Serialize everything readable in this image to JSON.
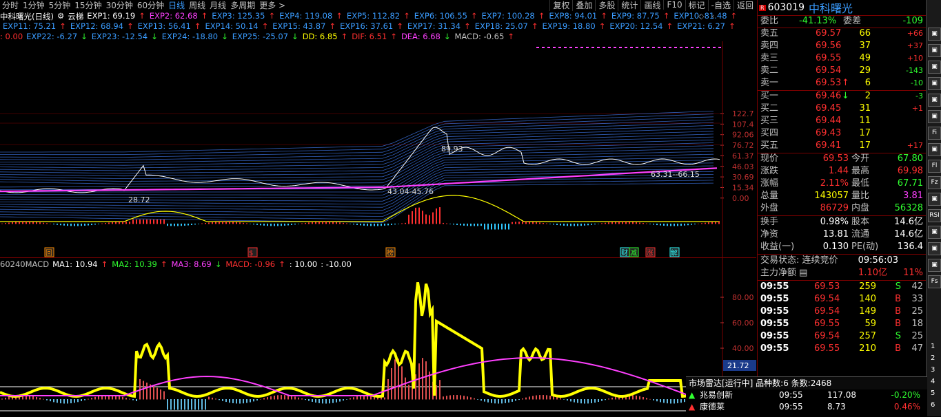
{
  "nav": {
    "periods": [
      "分时",
      "1分钟",
      "5分钟",
      "15分钟",
      "30分钟",
      "60分钟",
      "日线",
      "周线",
      "月线",
      "多周期",
      "更多 >"
    ],
    "active": "日线",
    "right_tabs": [
      "复权",
      "叠加",
      "多股",
      "统计",
      "画线",
      "F10",
      "标记",
      "-自选",
      "返回"
    ]
  },
  "legend1": {
    "title": "中科曙光(日线)",
    "indicator": "云梯",
    "items": [
      {
        "t": "EXP1: 69.19",
        "c": "#ffffff",
        "a": "↑",
        "ac": "#ff3030"
      },
      {
        "t": "EXP2: 62.68",
        "c": "#ff40ff",
        "a": "↑",
        "ac": "#ff3030"
      },
      {
        "t": "EXP3: 125.35",
        "c": "#3a9cff",
        "a": "↑",
        "ac": "#ff3030"
      },
      {
        "t": "EXP4: 119.08",
        "c": "#3a9cff",
        "a": "↑",
        "ac": "#ff3030"
      },
      {
        "t": "EXP5: 112.82",
        "c": "#3a9cff",
        "a": "↑",
        "ac": "#ff3030"
      },
      {
        "t": "EXP6: 106.55",
        "c": "#3a9cff",
        "a": "↑",
        "ac": "#ff3030"
      },
      {
        "t": "EXP7: 100.28",
        "c": "#3a9cff",
        "a": "↑",
        "ac": "#ff3030"
      },
      {
        "t": "EXP8: 94.01",
        "c": "#3a9cff",
        "a": "↑",
        "ac": "#ff3030"
      },
      {
        "t": "EXP9: 87.75",
        "c": "#3a9cff",
        "a": "↑",
        "ac": "#ff3030"
      },
      {
        "t": "EXP10: 81.48",
        "c": "#3a9cff",
        "a": "↑",
        "ac": "#ff3030"
      }
    ]
  },
  "legend2": {
    "items": [
      {
        "t": "EXP11: 75.21",
        "c": "#3a9cff",
        "a": "↑",
        "ac": "#ff3030"
      },
      {
        "t": "EXP12: 68.94",
        "c": "#3a9cff",
        "a": "↑",
        "ac": "#ff3030"
      },
      {
        "t": "EXP13: 56.41",
        "c": "#3a9cff",
        "a": "↑",
        "ac": "#ff3030"
      },
      {
        "t": "EXP14: 50.14",
        "c": "#3a9cff",
        "a": "↑",
        "ac": "#ff3030"
      },
      {
        "t": "EXP15: 43.87",
        "c": "#3a9cff",
        "a": "↑",
        "ac": "#ff3030"
      },
      {
        "t": "EXP16: 37.61",
        "c": "#3a9cff",
        "a": "↑",
        "ac": "#ff3030"
      },
      {
        "t": "EXP17: 31.34",
        "c": "#3a9cff",
        "a": "↑",
        "ac": "#ff3030"
      },
      {
        "t": "EXP18: 25.07",
        "c": "#3a9cff",
        "a": "↑",
        "ac": "#ff3030"
      },
      {
        "t": "EXP19: 18.80",
        "c": "#3a9cff",
        "a": "↑",
        "ac": "#ff3030"
      },
      {
        "t": "EXP20: 12.54",
        "c": "#3a9cff",
        "a": "↑",
        "ac": "#ff3030"
      },
      {
        "t": "EXP21: 6.27",
        "c": "#3a9cff",
        "a": "↑",
        "ac": "#ff3030"
      }
    ]
  },
  "legend3": {
    "items": [
      {
        "t": ": 0.00",
        "c": "#ff3030",
        "a": "",
        "ac": ""
      },
      {
        "t": "EXP22: -6.27",
        "c": "#3a9cff",
        "a": "↓",
        "ac": "#30ff30"
      },
      {
        "t": "EXP23: -12.54",
        "c": "#3a9cff",
        "a": "↓",
        "ac": "#30ff30"
      },
      {
        "t": "EXP24: -18.80",
        "c": "#3a9cff",
        "a": "↓",
        "ac": "#30ff30"
      },
      {
        "t": "EXP25: -25.07",
        "c": "#3a9cff",
        "a": "↓",
        "ac": "#30ff30"
      },
      {
        "t": "DD: 6.85",
        "c": "#ffff00",
        "a": "↑",
        "ac": "#ff3030"
      },
      {
        "t": "DIF: 6.51",
        "c": "#ff3030",
        "a": "↑",
        "ac": "#ff3030"
      },
      {
        "t": "DEA: 6.68",
        "c": "#ff40ff",
        "a": "↓",
        "ac": "#30ff30"
      },
      {
        "t": "MACD: -0.65",
        "c": "#c0c0c0",
        "a": "↑",
        "ac": "#ff3030"
      }
    ]
  },
  "legend_sub": {
    "items": [
      {
        "t": "60240MACD",
        "c": "#c0c0c0",
        "a": "",
        "ac": ""
      },
      {
        "t": "MA1: 10.94",
        "c": "#ffffff",
        "a": "↑",
        "ac": "#ff3030"
      },
      {
        "t": "MA2: 10.39",
        "c": "#30ff30",
        "a": "↑",
        "ac": "#ff3030"
      },
      {
        "t": "MA3: 8.69",
        "c": "#ff40ff",
        "a": "↓",
        "ac": "#30ff30"
      },
      {
        "t": "MACD: -0.96",
        "c": "#ff3030",
        "a": "↑",
        "ac": "#ff3030"
      },
      {
        "t": ": 10.00",
        "c": "#ffffff",
        "a": "",
        "ac": ""
      },
      {
        "t": ": -10.00",
        "c": "#ffffff",
        "a": "",
        "ac": ""
      }
    ]
  },
  "main_axis": [
    "122.7",
    "107.4",
    "92.06",
    "76.72",
    "61.37",
    "46.03",
    "30.69",
    "15.34",
    "0.00"
  ],
  "sub_axis": [
    "80.00",
    "60.00",
    "40.00"
  ],
  "sub_current": "21.72",
  "annotations": {
    "high": "89.93",
    "mid": "43.04-45.76",
    "low": "28.72",
    "range": "63.31--66.15"
  },
  "markers": [
    {
      "t": "回",
      "c": "#ff8c00"
    },
    {
      "t": "$",
      "c": "#ff3030"
    },
    {
      "t": "榜",
      "c": "#ff8c00"
    },
    {
      "t": "财",
      "c": "#30ffff"
    },
    {
      "t": "减",
      "c": "#30ff30"
    },
    {
      "t": "涨",
      "c": "#ff3030"
    },
    {
      "t": "解",
      "c": "#30ffff"
    }
  ],
  "quote": {
    "badge": "R",
    "code": "603019",
    "name": "中科曙光",
    "weibi_label": "委比",
    "weibi": "-41.13%",
    "weicha_label": "委差",
    "weicha": "-109",
    "asks": [
      {
        "l": "卖五",
        "p": "69.57",
        "v": "66",
        "d": "+66",
        "dc": "#ff3030"
      },
      {
        "l": "卖四",
        "p": "69.56",
        "v": "37",
        "d": "+37",
        "dc": "#ff3030"
      },
      {
        "l": "卖三",
        "p": "69.55",
        "v": "49",
        "d": "+10",
        "dc": "#ff3030"
      },
      {
        "l": "卖二",
        "p": "69.54",
        "v": "29",
        "d": "-143",
        "dc": "#30ff30"
      },
      {
        "l": "卖一",
        "p": "69.53",
        "v": "6",
        "d": "-10",
        "dc": "#30ff30",
        "arrow": "↑",
        "ac": "#ff3030"
      }
    ],
    "bids": [
      {
        "l": "买一",
        "p": "69.46",
        "v": "2",
        "d": "-3",
        "dc": "#30ff30",
        "arrow": "↓",
        "ac": "#30ff30"
      },
      {
        "l": "买二",
        "p": "69.45",
        "v": "31",
        "d": "+1",
        "dc": "#ff3030"
      },
      {
        "l": "买三",
        "p": "69.44",
        "v": "11",
        "d": "",
        "dc": "#ff3030"
      },
      {
        "l": "买四",
        "p": "69.43",
        "v": "17",
        "d": "",
        "dc": "#ff3030"
      },
      {
        "l": "买五",
        "p": "69.41",
        "v": "17",
        "d": "+17",
        "dc": "#ff3030"
      }
    ],
    "stats": [
      {
        "l1": "现价",
        "v1": "69.53",
        "c1": "#ff3030",
        "l2": "今开",
        "v2": "67.80",
        "c2": "#30ff30"
      },
      {
        "l1": "涨跌",
        "v1": "1.44",
        "c1": "#ff3030",
        "l2": "最高",
        "v2": "69.98",
        "c2": "#ff3030"
      },
      {
        "l1": "涨幅",
        "v1": "2.11%",
        "c1": "#ff3030",
        "l2": "最低",
        "v2": "67.71",
        "c2": "#30ff30"
      },
      {
        "l1": "总量",
        "v1": "143057",
        "c1": "#ffff00",
        "l2": "量比",
        "v2": "3.81",
        "c2": "#ff40ff"
      },
      {
        "l1": "外盘",
        "v1": "86729",
        "c1": "#ff3030",
        "l2": "内盘",
        "v2": "56328",
        "c2": "#30ff30"
      }
    ],
    "stats2": [
      {
        "l1": "换手",
        "v1": "0.98%",
        "c1": "#ffffff",
        "l2": "股本",
        "v2": "14.6亿",
        "c2": "#ffffff"
      },
      {
        "l1": "净资",
        "v1": "13.81",
        "c1": "#ffffff",
        "l2": "流通",
        "v2": "14.6亿",
        "c2": "#ffffff"
      },
      {
        "l1": "收益(一)",
        "v1": "0.130",
        "c1": "#ffffff",
        "l2": "PE(动)",
        "v2": "136.4",
        "c2": "#ffffff"
      }
    ],
    "trade_status_label": "交易状态: 连续竞价",
    "trade_status_time": "09:56:03",
    "flow_label": "主力净额",
    "flow_value": "1.10亿",
    "flow_pct": "11%",
    "ticks": [
      {
        "t": "09:55",
        "p": "69.53",
        "v": "259",
        "s": "S",
        "n": "42"
      },
      {
        "t": "09:55",
        "p": "69.54",
        "v": "140",
        "s": "B",
        "n": "33"
      },
      {
        "t": "09:55",
        "p": "69.54",
        "v": "149",
        "s": "B",
        "n": "25"
      },
      {
        "t": "09:55",
        "p": "69.55",
        "v": "59",
        "s": "B",
        "n": "18"
      },
      {
        "t": "09:55",
        "p": "69.54",
        "v": "257",
        "s": "S",
        "n": "25"
      },
      {
        "t": "09:55",
        "p": "69.55",
        "v": "210",
        "s": "B",
        "n": "47"
      }
    ]
  },
  "radar": {
    "title": "市场雷达[运行中] 品种数:6 条数:2468",
    "rows": [
      {
        "name": "兆易创新",
        "time": "09:55",
        "price": "117.08",
        "pct": "-0.20%",
        "pc": "#30ff30"
      },
      {
        "name": "康德莱",
        "time": "09:55",
        "price": "8.73",
        "pct": "0.46%",
        "pc": "#ff3030"
      }
    ]
  },
  "toolbar_icons": [
    "chart-icon",
    "grid-icon",
    "list-icon",
    "wave-icon",
    "candle-icon",
    "bar-icon",
    "fi-icon",
    "diagram-icon",
    "fl-icon",
    "fz-icon",
    "fund-icon",
    "rsi-icon",
    "trend-icon",
    "up-icon",
    "down-icon",
    "fs-icon"
  ],
  "toolbar_labels": [
    "",
    "",
    "",
    "",
    "",
    "",
    "Fi",
    "",
    "Fl",
    "Fz",
    "",
    "RSI",
    "",
    "",
    "",
    "Fs"
  ],
  "page_labels": [
    "1",
    "2",
    "3",
    "4",
    "5",
    "6"
  ]
}
